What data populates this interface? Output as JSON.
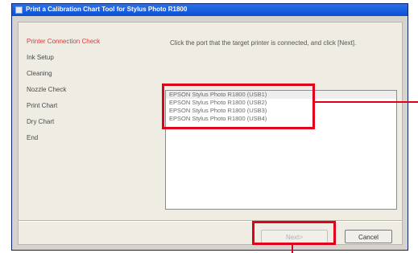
{
  "window": {
    "title": "Print a Calibration Chart Tool for Stylus Photo R1800"
  },
  "steps": [
    {
      "label": "Printer Connection Check",
      "active": true
    },
    {
      "label": "Ink Setup",
      "active": false
    },
    {
      "label": "Cleaning",
      "active": false
    },
    {
      "label": "Nozzle Check",
      "active": false
    },
    {
      "label": "Print Chart",
      "active": false
    },
    {
      "label": "Dry Chart",
      "active": false
    },
    {
      "label": "End",
      "active": false
    }
  ],
  "instruction": "Click the port that the target printer is connected, and click [Next].",
  "ports": [
    "EPSON Stylus Photo R1800 (USB1)",
    "EPSON Stylus Photo R1800 (USB2)",
    "EPSON Stylus Photo R1800 (USB3)",
    "EPSON Stylus Photo R1800 (USB4)"
  ],
  "buttons": {
    "next": "Next>",
    "cancel": "Cancel"
  },
  "colors": {
    "highlight": "#e0001a",
    "active_step": "#d93a3a",
    "titlebar": "#0a4fd6"
  }
}
